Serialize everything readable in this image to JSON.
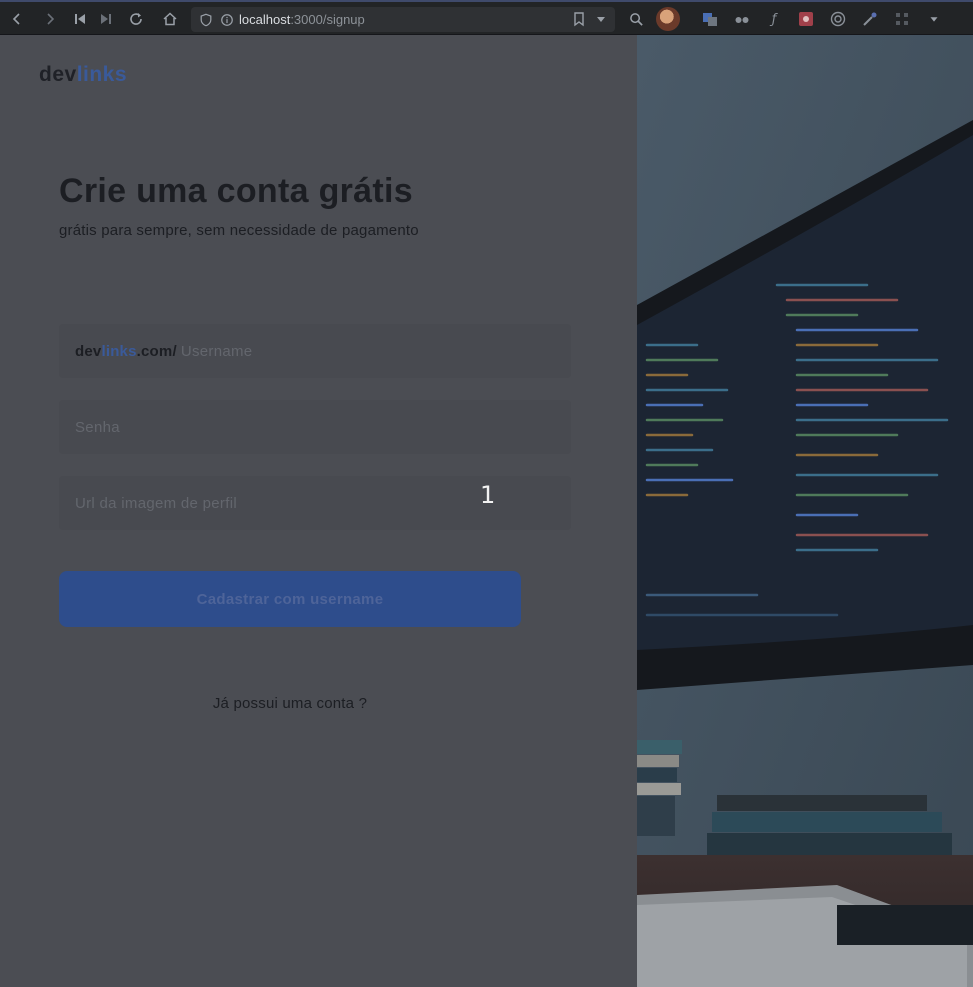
{
  "browser": {
    "url_host": "localhost",
    "url_path": ":3000/signup"
  },
  "logo": {
    "part1": "dev",
    "part2": "links"
  },
  "form": {
    "title": "Crie uma conta grátis",
    "subtitle": "grátis para sempre, sem necessidade de pagamento",
    "username_prefix_a": "dev",
    "username_prefix_b": "links",
    "username_prefix_c": ".com/",
    "username_placeholder": "Username",
    "password_placeholder": "Senha",
    "avatar_url_placeholder": "Url da imagem de perfil",
    "submit_label": "Cadastrar com username",
    "login_link": "Já possui uma conta ?"
  },
  "overlay_badge": "1",
  "colors": {
    "accent": "#3a5a9a",
    "button": "#2e4d8c",
    "panel": "#4b4d53"
  }
}
